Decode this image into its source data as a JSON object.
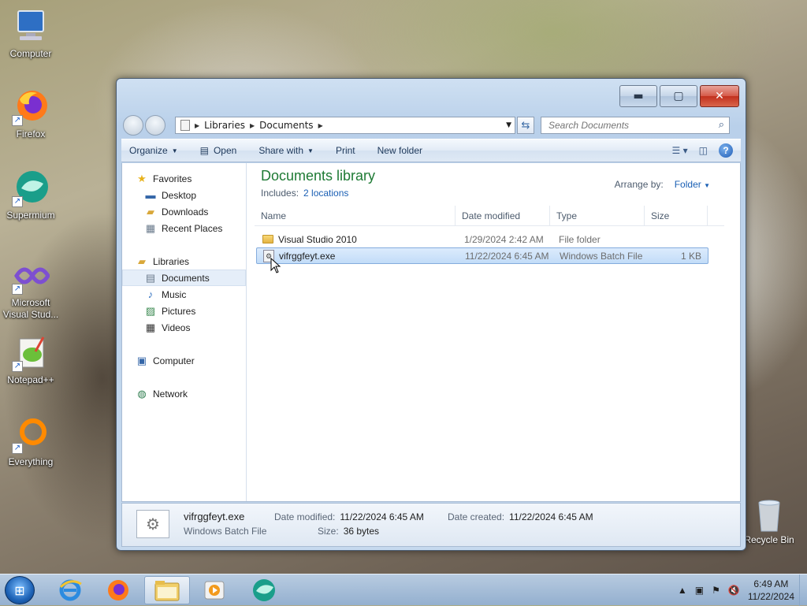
{
  "desktop": {
    "icons": [
      {
        "label": "Computer"
      },
      {
        "label": "Firefox"
      },
      {
        "label": "Supermium"
      },
      {
        "label": "Microsoft Visual Stud..."
      },
      {
        "label": "Notepad++"
      },
      {
        "label": "Everything"
      }
    ],
    "recycle_bin": "Recycle Bin"
  },
  "window": {
    "address": {
      "crumbs": [
        "Libraries",
        "Documents"
      ]
    },
    "search": {
      "placeholder": "Search Documents"
    },
    "toolbar": {
      "organize": "Organize",
      "open": "Open",
      "share_with": "Share with",
      "print": "Print",
      "new_folder": "New folder"
    },
    "nav": {
      "favorites": "Favorites",
      "desktop": "Desktop",
      "downloads": "Downloads",
      "recent_places": "Recent Places",
      "libraries": "Libraries",
      "documents": "Documents",
      "music": "Music",
      "pictures": "Pictures",
      "videos": "Videos",
      "computer": "Computer",
      "network": "Network"
    },
    "library": {
      "title": "Documents library",
      "includes_label": "Includes:",
      "includes_link": "2 locations",
      "arrange_label": "Arrange by:",
      "arrange_value": "Folder"
    },
    "columns": {
      "name": "Name",
      "date": "Date modified",
      "type": "Type",
      "size": "Size"
    },
    "files": [
      {
        "name": "Visual Studio 2010",
        "date": "1/29/2024 2:42 AM",
        "type": "File folder",
        "size": ""
      },
      {
        "name": "vifrggfeyt.exe",
        "date": "11/22/2024 6:45 AM",
        "type": "Windows Batch File",
        "size": "1 KB"
      }
    ],
    "details": {
      "name": "vifrggfeyt.exe",
      "type": "Windows Batch File",
      "modified_label": "Date modified:",
      "modified_value": "11/22/2024 6:45 AM",
      "size_label": "Size:",
      "size_value": "36 bytes",
      "created_label": "Date created:",
      "created_value": "11/22/2024 6:45 AM"
    }
  },
  "taskbar": {
    "time": "6:49 AM",
    "date": "11/22/2024"
  }
}
